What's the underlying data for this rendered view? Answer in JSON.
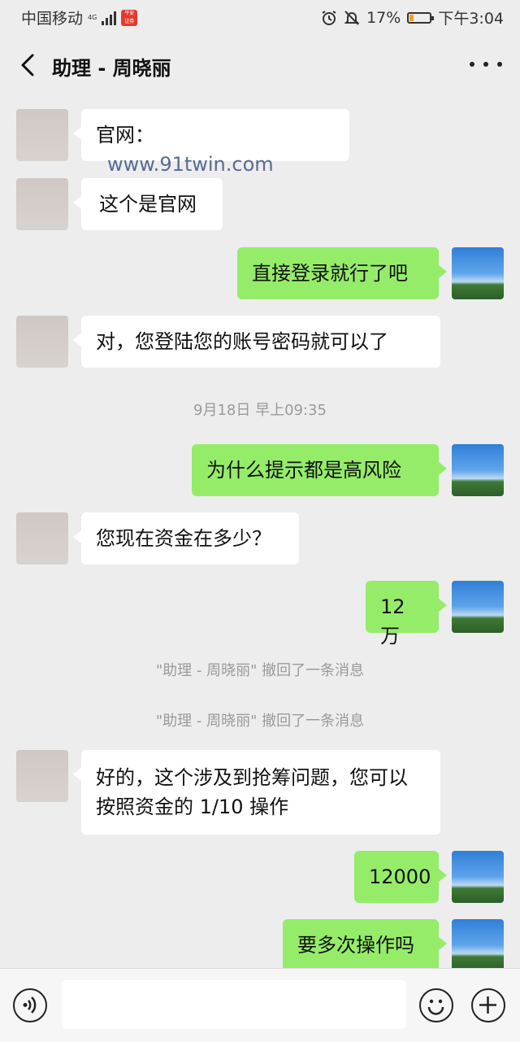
{
  "status_bar": {
    "carrier": "中国移动",
    "network": "4G",
    "battery_percent": "17%",
    "battery_level": 0.17,
    "time": "下午3:04"
  },
  "header": {
    "title": "助理 - 周晓丽"
  },
  "messages": [
    {
      "side": "in",
      "prefix": "官网：",
      "url": "www.91twin.com"
    },
    {
      "side": "in",
      "text": "这个是官网"
    },
    {
      "side": "out",
      "text": "直接登录就行了吧"
    },
    {
      "side": "in",
      "text": "对，您登陆您的账号密码就可以了"
    },
    {
      "system": "9月18日 早上09:35"
    },
    {
      "side": "out",
      "text": "为什么提示都是高风险"
    },
    {
      "side": "in",
      "text": "您现在资金在多少？"
    },
    {
      "side": "out",
      "text": "12万"
    },
    {
      "system": "\"助理 - 周晓丽\" 撤回了一条消息"
    },
    {
      "system": "\"助理 - 周晓丽\" 撤回了一条消息"
    },
    {
      "side": "in",
      "text": "好的，这个涉及到抢筹问题，您可以按照资金的 1/10 操作"
    },
    {
      "side": "out",
      "text": "12000"
    },
    {
      "side": "out",
      "text": "要多次操作吗"
    }
  ],
  "icons": {
    "back": "chevron-left-icon",
    "more": "more-dots-icon",
    "voice": "voice-icon",
    "emoji": "emoji-icon",
    "plus": "plus-icon"
  },
  "colors": {
    "background": "#ededed",
    "outgoing_bubble": "#95ec69",
    "incoming_bubble": "#ffffff",
    "link": "#576b95"
  }
}
